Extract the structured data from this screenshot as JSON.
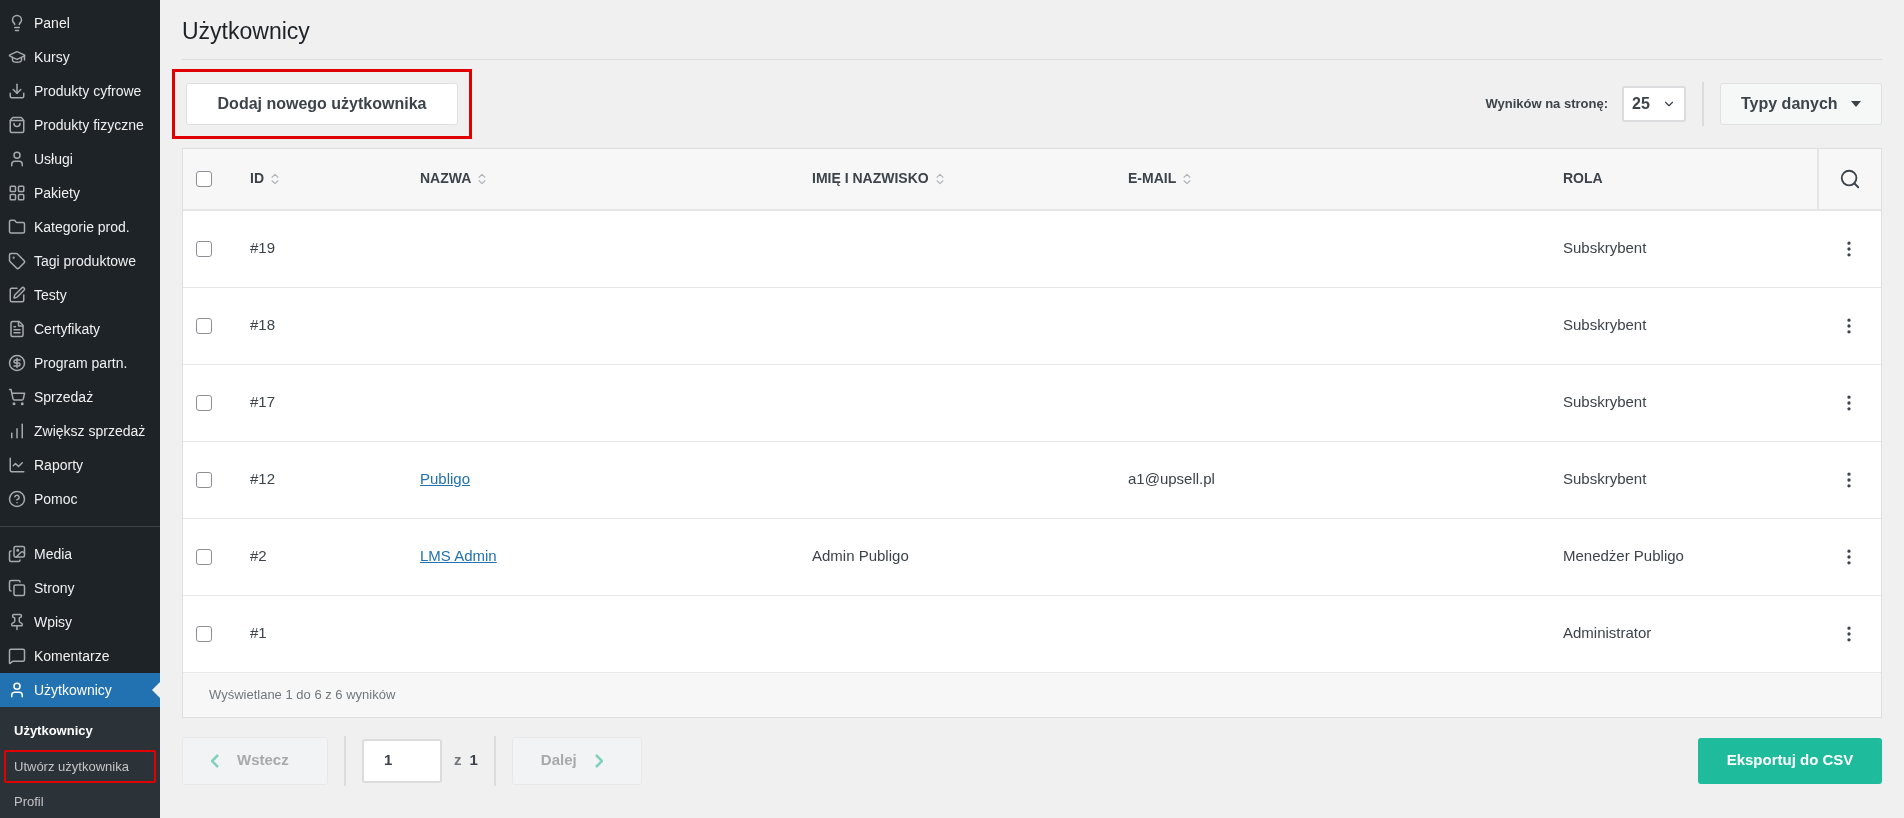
{
  "sidebar": {
    "groups": [
      {
        "items": [
          {
            "label": "Panel",
            "selected": false
          },
          {
            "label": "Kursy",
            "selected": false
          },
          {
            "label": "Produkty cyfrowe",
            "selected": false
          },
          {
            "label": "Produkty fizyczne",
            "selected": false
          },
          {
            "label": "Usługi",
            "selected": false
          },
          {
            "label": "Pakiety",
            "selected": false
          },
          {
            "label": "Kategorie prod.",
            "selected": false
          },
          {
            "label": "Tagi produktowe",
            "selected": false
          },
          {
            "label": "Testy",
            "selected": false
          },
          {
            "label": "Certyfikaty",
            "selected": false
          },
          {
            "label": "Program partn.",
            "selected": false
          },
          {
            "label": "Sprzedaż",
            "selected": false
          },
          {
            "label": "Zwiększ sprzedaż",
            "selected": false
          },
          {
            "label": "Raporty",
            "selected": false
          },
          {
            "label": "Pomoc",
            "selected": false
          }
        ]
      },
      {
        "items": [
          {
            "label": "Media",
            "selected": false
          },
          {
            "label": "Strony",
            "selected": false
          },
          {
            "label": "Wpisy",
            "selected": false
          },
          {
            "label": "Komentarze",
            "selected": false
          },
          {
            "label": "Użytkownicy",
            "selected": true
          }
        ]
      }
    ],
    "submenu": [
      {
        "label": "Użytkownicy",
        "selected": true,
        "highlighted": false
      },
      {
        "label": "Utwórz użytkownika",
        "selected": false,
        "highlighted": true
      },
      {
        "label": "Profil",
        "selected": false,
        "highlighted": false
      }
    ]
  },
  "page_title": "Użytkownicy",
  "add_button": {
    "label": "Dodaj nowego użytkownika",
    "highlighted": true
  },
  "per_page": {
    "label": "Wyników na stronę:",
    "value": "25"
  },
  "data_types_button": "Typy danych",
  "table": {
    "columns": [
      {
        "label": "ID",
        "sortable": true
      },
      {
        "label": "NAZWA",
        "sortable": true
      },
      {
        "label": "IMIĘ I NAZWISKO",
        "sortable": true
      },
      {
        "label": "E-MAIL",
        "sortable": true
      },
      {
        "label": "ROLA",
        "sortable": false
      }
    ],
    "all_checked": false,
    "rows": [
      {
        "checked": false,
        "id": "#19",
        "name": "",
        "full_name": "",
        "email": "",
        "role": "Subskrybent"
      },
      {
        "checked": false,
        "id": "#18",
        "name": "",
        "full_name": "",
        "email": "",
        "role": "Subskrybent"
      },
      {
        "checked": false,
        "id": "#17",
        "name": "",
        "full_name": "",
        "email": "",
        "role": "Subskrybent"
      },
      {
        "checked": false,
        "id": "#12",
        "name": "Publigo",
        "full_name": "",
        "email": "a1@upsell.pl",
        "role": "Subskrybent"
      },
      {
        "checked": false,
        "id": "#2",
        "name": "LMS Admin",
        "full_name": "Admin Publigo",
        "email": "",
        "role": "Menedżer Publigo"
      },
      {
        "checked": false,
        "id": "#1",
        "name": "",
        "full_name": "",
        "email": "",
        "role": "Administrator"
      }
    ],
    "footer": "Wyświetlane 1 do 6 z 6 wyników"
  },
  "pagination": {
    "prev": {
      "label": "Wstecz",
      "disabled": true
    },
    "page": "1",
    "of_label": "z",
    "total": "1",
    "next": {
      "label": "Dalej",
      "disabled": true
    }
  },
  "export_button": "Eksportuj do CSV"
}
